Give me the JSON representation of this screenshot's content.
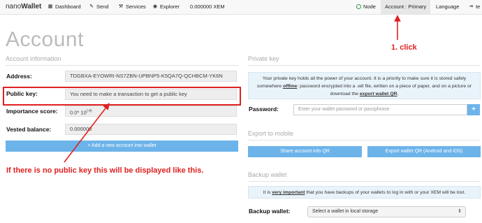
{
  "nav": {
    "brand_light": "nano",
    "brand_bold": "Wallet",
    "dashboard": "Dashboard",
    "send": "Send",
    "services": "Services",
    "explorer": "Explorer",
    "balance": "0.000000 XEM",
    "node": "Node",
    "account": "Account : Primary",
    "language": "Language",
    "cut": "te"
  },
  "page": {
    "title": "Account"
  },
  "account_info": {
    "section": "Account information",
    "address_label": "Address:",
    "address_value": "TDGBXA-EYOWRI-NS7ZBN-UPBNP5-K5QA7Q-QCHBCM-YK6N",
    "pubkey_label": "Public key:",
    "pubkey_value": "You need to make a transaction to get a public key",
    "importance_label": "Importance score:",
    "importance_value": "0.0* 10",
    "importance_exp": "(-4)",
    "vested_label": "Vested balance:",
    "vested_value": "0.000000",
    "add_button": "+ Add a new account into wallet"
  },
  "private_key": {
    "section": "Private key",
    "info_1": "Your private key holds all the power of your account. It is a priority to make sure it is stored safely somewhere ",
    "info_offline": "offline",
    "info_2": ": password encrypted into a .wlt file, written on a piece of paper, and on a picture or download the ",
    "info_link": "export wallet QR",
    "info_3": ".",
    "password_label": "Password:",
    "password_placeholder": "Enter your wallet password or passphrase",
    "plus": "+"
  },
  "export_mobile": {
    "section": "Export to mobile",
    "share_button": "Share account info QR",
    "export_button": "Export wallet QR (Android and IOS)"
  },
  "backup": {
    "section": "Backup wallet",
    "info_1": "It is ",
    "info_important": "very important",
    "info_2": " that you have backups of your wallets to log in with or your XEM will be lost.",
    "label": "Backup wallet:",
    "select_value": "Select a wallet in local storage"
  },
  "annotations": {
    "click": "1. click",
    "no_pubkey": "If there is no public key this will be displayed like this."
  },
  "colors": {
    "annotation": "#e02020",
    "button": "#6cb3ea",
    "info_bg": "#e9f3fa"
  }
}
